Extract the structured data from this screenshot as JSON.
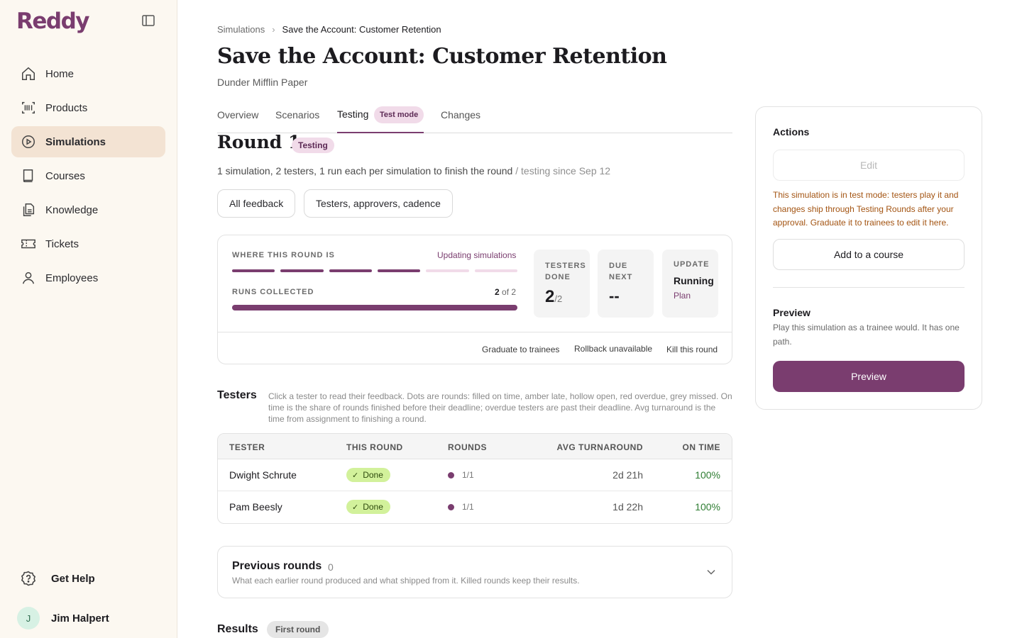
{
  "app": {
    "logo": "Reddy"
  },
  "sidebar": {
    "items": [
      {
        "label": "Home",
        "icon": "home-icon"
      },
      {
        "label": "Products",
        "icon": "barcode-icon"
      },
      {
        "label": "Simulations",
        "icon": "play-circle-icon",
        "active": true
      },
      {
        "label": "Courses",
        "icon": "book-icon"
      },
      {
        "label": "Knowledge",
        "icon": "documents-icon"
      },
      {
        "label": "Tickets",
        "icon": "ticket-icon"
      },
      {
        "label": "Employees",
        "icon": "user-icon"
      }
    ],
    "help_label": "Get Help",
    "user": {
      "initial": "J",
      "name": "Jim Halpert"
    }
  },
  "breadcrumb": {
    "parent": "Simulations",
    "current": "Save the Account: Customer Retention"
  },
  "page": {
    "title": "Save the Account: Customer Retention",
    "subtitle": "Dunder Mifflin Paper"
  },
  "tabs": [
    {
      "label": "Overview"
    },
    {
      "label": "Scenarios"
    },
    {
      "label": "Testing",
      "active": true,
      "badge": "Test mode"
    },
    {
      "label": "Changes"
    }
  ],
  "round": {
    "title": "Round 1",
    "badge": "Testing",
    "description": "1 simulation, 2 testers, 1 run each per simulation to finish the round",
    "description_muted": "/ testing since Sep 12",
    "buttons": {
      "feedback": "All feedback",
      "settings": "Testers, approvers, cadence"
    }
  },
  "status": {
    "where_label": "WHERE THIS ROUND IS",
    "stage_link": "Updating simulations",
    "stages_total": 6,
    "stages_completed": 4,
    "runs_label": "RUNS COLLECTED",
    "runs_value": "2",
    "runs_of": "of 2",
    "runs_fraction": 1.0,
    "testers_done": {
      "label_line1": "TESTERS",
      "label_line2": "DONE",
      "value": "2",
      "total": "/2"
    },
    "due_next": {
      "label_line1": "DUE",
      "label_line2": "NEXT",
      "value": "--"
    },
    "update": {
      "label": "UPDATE",
      "value": "Running",
      "link": "Plan"
    },
    "footer": {
      "graduate": "Graduate to trainees",
      "rollback": "Rollback unavailable",
      "kill": "Kill this round"
    }
  },
  "testers": {
    "heading": "Testers",
    "note": "Click a tester to read their feedback. Dots are rounds: filled on time, amber late, hollow open, red overdue, grey missed. On time is the share of rounds finished before their deadline; overdue testers are past their deadline. Avg turnaround is the time from assignment to finishing a round.",
    "columns": [
      "TESTER",
      "THIS ROUND",
      "ROUNDS",
      "AVG TURNAROUND",
      "ON TIME"
    ],
    "rows": [
      {
        "name": "Dwight Schrute",
        "status": "Done",
        "rounds": "1/1",
        "turnaround": "2d 21h",
        "on_time": "100%"
      },
      {
        "name": "Pam Beesly",
        "status": "Done",
        "rounds": "1/1",
        "turnaround": "1d 22h",
        "on_time": "100%"
      }
    ]
  },
  "previous_rounds": {
    "title": "Previous rounds",
    "count": "0",
    "description": "What each earlier round produced and what shipped from it. Killed rounds keep their results."
  },
  "results": {
    "heading": "Results",
    "badge": "First round"
  },
  "actions": {
    "heading": "Actions",
    "edit_label": "Edit",
    "warning": "This simulation is in test mode: testers play it and changes ship through Testing Rounds after your approval. Graduate it to trainees to edit it here.",
    "add_course_label": "Add to a course",
    "preview_heading": "Preview",
    "preview_desc": "Play this simulation as a trainee would. It has one path.",
    "preview_button": "Preview"
  },
  "colors": {
    "accent": "#7a3d6f",
    "accent_light": "#f1dbe9",
    "success_text": "#2e7d32",
    "done_badge_bg": "#d2f19b",
    "warning_text": "#a35412",
    "sidebar_bg": "#fcf8f1",
    "active_nav_bg": "#f3e3d3"
  }
}
